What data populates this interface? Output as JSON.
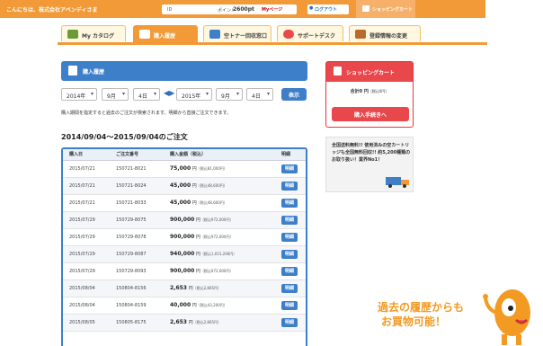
{
  "header": {
    "greeting": "こんにちは、株式会社アベンディさま",
    "id_label": "ID",
    "point_label": "ポイント",
    "points": "2600pt",
    "mypage": "Myページ",
    "logout": "ログアウト",
    "cart": "ショッピングカート"
  },
  "tabs": [
    {
      "label": "My カタログ"
    },
    {
      "label": "購入履歴"
    },
    {
      "label": "空トナー回収窓口"
    },
    {
      "label": "サポートデスク"
    },
    {
      "label": "登録情報の変更"
    }
  ],
  "panel": {
    "title": "購入履歴"
  },
  "filter": {
    "from_year": "2014年",
    "from_month": "9月",
    "from_day": "4日",
    "to_year": "2015年",
    "to_month": "9月",
    "to_day": "4日",
    "show": "表示",
    "note": "購入期間を指定すると過去のご注文が検索されます。明細から直接ご注文できます。"
  },
  "orders_title": "2014/09/04〜2015/09/04のご注文",
  "table": {
    "headers": [
      "購入日",
      "ご注文番号",
      "購入金額（税込）",
      "明細"
    ],
    "rows": [
      {
        "date": "2015/07/21",
        "no": "150721-8021",
        "amt": "75,000",
        "tax": "（税込81,000円）"
      },
      {
        "date": "2015/07/21",
        "no": "150721-8024",
        "amt": "45,000",
        "tax": "（税込48,600円）"
      },
      {
        "date": "2015/07/21",
        "no": "150721-8033",
        "amt": "45,000",
        "tax": "（税込48,600円）"
      },
      {
        "date": "2015/07/29",
        "no": "150729-8075",
        "amt": "900,000",
        "tax": "（税込972,000円）"
      },
      {
        "date": "2015/07/29",
        "no": "150729-8078",
        "amt": "900,000",
        "tax": "（税込972,000円）"
      },
      {
        "date": "2015/07/29",
        "no": "150729-8087",
        "amt": "940,000",
        "tax": "（税込1,015,200円）"
      },
      {
        "date": "2015/07/29",
        "no": "150729-8093",
        "amt": "900,000",
        "tax": "（税込972,000円）"
      },
      {
        "date": "2015/08/04",
        "no": "150804-8156",
        "amt": "2,653",
        "tax": "（税込2,865円）"
      },
      {
        "date": "2015/08/04",
        "no": "150804-8159",
        "amt": "40,000",
        "tax": "（税込43,200円）"
      },
      {
        "date": "2015/08/05",
        "no": "150805-8175",
        "amt": "2,653",
        "tax": "（税込2,865円）"
      }
    ],
    "yen": "円",
    "detail_btn": "明細"
  },
  "cart": {
    "title": "ショッピングカート",
    "total": "合計0 円",
    "total_tax": "（税込0円）",
    "proceed": "購入手続きへ"
  },
  "promo": {
    "text": "全国送料無料!! 使用済みの空カートリッジも全国無料回収!! 約5,200種類のお取り扱い！業界No1！"
  },
  "caption": {
    "line1": "過去の履歴からも",
    "line2": "お買物可能！"
  },
  "colors": {
    "orange": "#f29a38",
    "blue": "#3d7fc9",
    "red": "#e8474c"
  }
}
